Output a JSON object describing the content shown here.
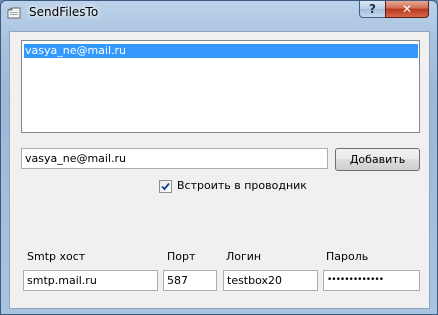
{
  "window": {
    "title": "SendFilesTo",
    "help_label": "?",
    "close_label": "✕"
  },
  "recipients": {
    "items": [
      "vasya_ne@mail.ru"
    ],
    "selected_index": 0
  },
  "email_input": {
    "value": "vasya_ne@mail.ru"
  },
  "add_button": {
    "label": "Добавить"
  },
  "explorer_checkbox": {
    "label": "Встроить в проводник",
    "checked": true
  },
  "smtp": {
    "host_label": "Smtp хост",
    "host_value": "smtp.mail.ru",
    "port_label": "Порт",
    "port_value": "587",
    "login_label": "Логин",
    "login_value": "testbox20",
    "password_label": "Пароль",
    "password_value": "•••••••••••••"
  },
  "colors": {
    "selection": "#3399ff",
    "frame": "#a9c3df"
  }
}
